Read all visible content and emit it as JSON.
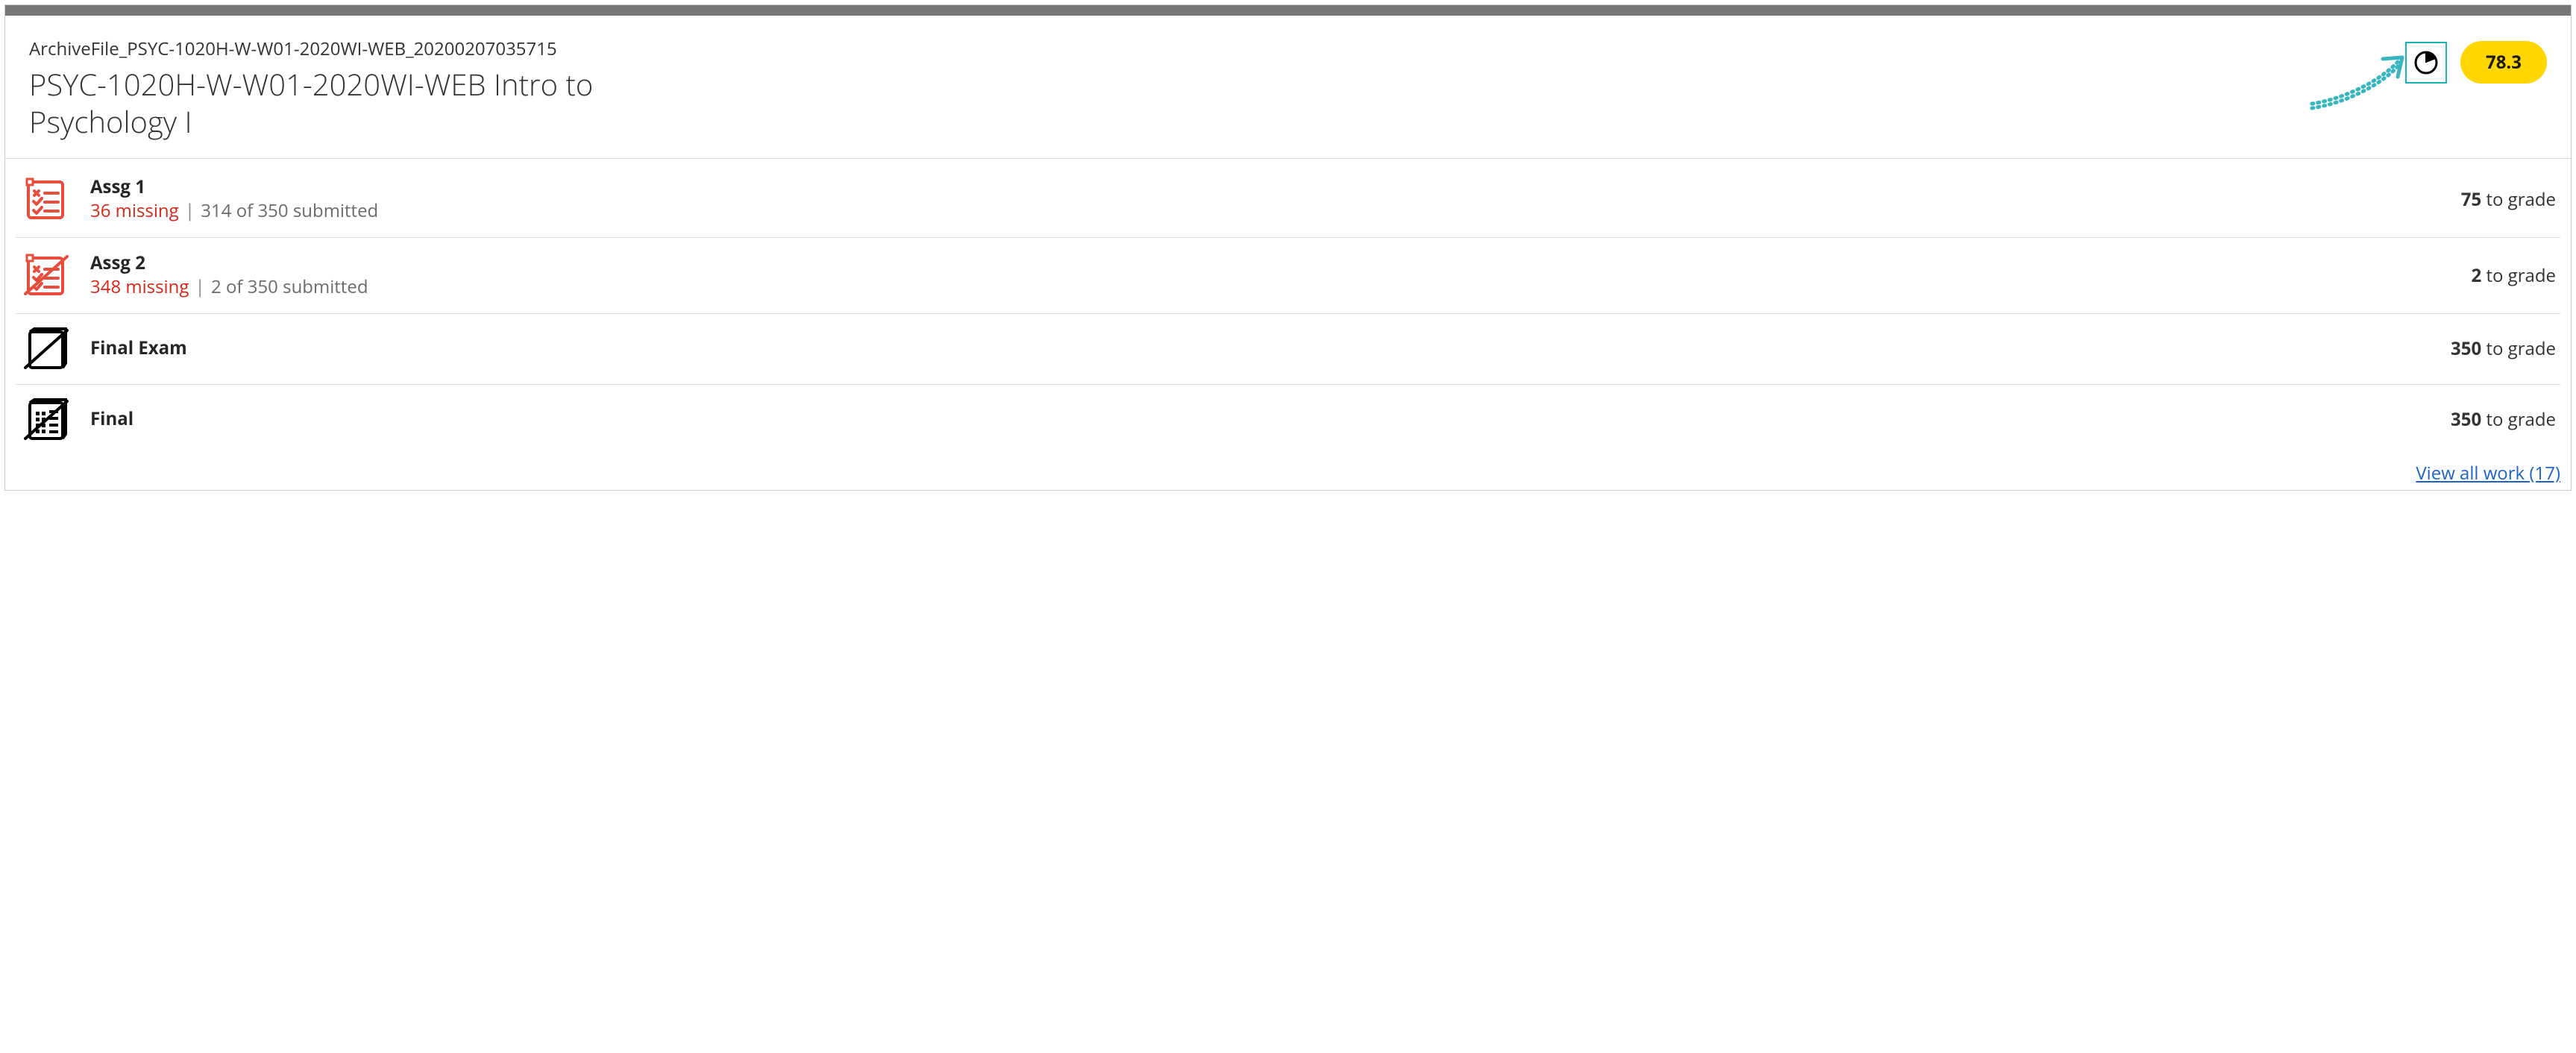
{
  "header": {
    "supertitle": "ArchiveFile_PSYC-1020H-W-W01-2020WI-WEB_20200207035715",
    "title": "PSYC-1020H-W-W01-2020WI-WEB Intro to Psychology I",
    "grade": "78.3"
  },
  "items": [
    {
      "id": "assg-1",
      "icon": "assignment",
      "name": "Assg 1",
      "missing": "36 missing",
      "submitted": "314 of 350 submitted",
      "to_grade_num": "75",
      "to_grade_label": " to grade",
      "slash": false
    },
    {
      "id": "assg-2",
      "icon": "assignment",
      "name": "Assg 2",
      "missing": "348 missing",
      "submitted": "2 of 350 submitted",
      "to_grade_num": "2",
      "to_grade_label": " to grade",
      "slash": true
    },
    {
      "id": "final-exam",
      "icon": "document",
      "name": "Final Exam",
      "missing": "",
      "submitted": "",
      "to_grade_num": "350",
      "to_grade_label": " to grade",
      "slash": true
    },
    {
      "id": "final",
      "icon": "grid-document",
      "name": "Final",
      "missing": "",
      "submitted": "",
      "to_grade_num": "350",
      "to_grade_label": " to grade",
      "slash": true
    }
  ],
  "footer": {
    "view_all": "View all work (17)"
  }
}
